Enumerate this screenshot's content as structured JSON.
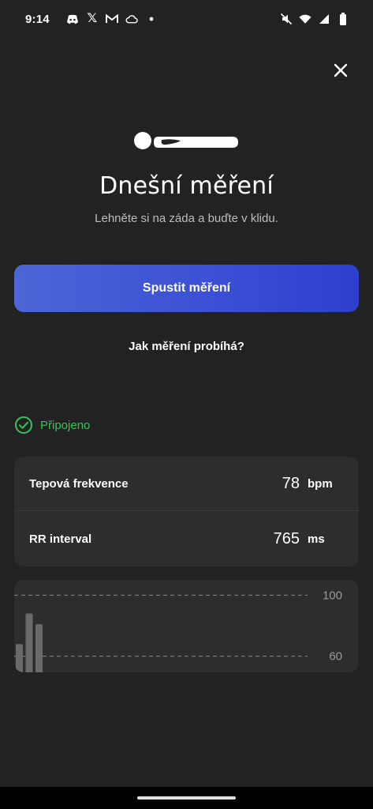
{
  "status_bar": {
    "time": "9:14",
    "notification_icons": [
      "discord-icon",
      "x-icon",
      "gmail-icon",
      "cloud-icon",
      "dot-icon"
    ],
    "x_glyph": "𝕏",
    "system_icons": [
      "mute-icon",
      "wifi-icon",
      "signal-icon",
      "battery-icon"
    ]
  },
  "header": {
    "close_icon": "close-icon"
  },
  "hero": {
    "icon": "lying-person-icon"
  },
  "title": "Dnešní měření",
  "subtitle": "Lehněte si na záda a buďte v klidu.",
  "start_button": {
    "label": "Spustit měření",
    "color_from": "#4c66d6",
    "color_to": "#2f3fce"
  },
  "how_link": "Jak měření probíhá?",
  "connection": {
    "status": "Připojeno",
    "color": "#37c25d",
    "icon": "check-circle-icon"
  },
  "metrics": [
    {
      "label": "Tepová frekvence",
      "value": "78",
      "unit": "bpm"
    },
    {
      "label": "RR interval",
      "value": "765",
      "unit": "ms"
    }
  ],
  "chart_data": {
    "type": "bar",
    "y_ticks": [
      "100",
      "60"
    ],
    "ylim": [
      50,
      110
    ],
    "values": [
      68,
      88,
      81
    ],
    "grid": "dashed",
    "bar_color": "#6a6a6a"
  }
}
